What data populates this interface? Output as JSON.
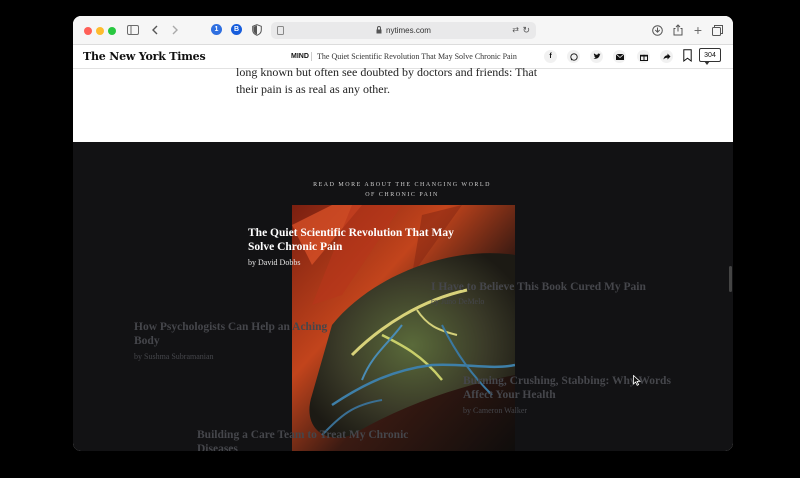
{
  "browser": {
    "url": "nytimes.com",
    "traffic_lights": [
      "#ff5f57",
      "#febc2e",
      "#28c840"
    ],
    "extensions": [
      "1Password",
      "Bitwarden",
      "Privacy shield"
    ]
  },
  "nyt_header": {
    "logo": "The New York Times",
    "section": "MIND",
    "article_title": "The Quiet Scientific Revolution That May Solve Chronic Pain",
    "share_buttons": [
      "facebook",
      "whatsapp",
      "twitter",
      "email",
      "gift",
      "share"
    ],
    "comments_count": "304"
  },
  "article": {
    "text_line1": "long known but often see doubted by doctors and friends: That",
    "text_line2": "their pain is as real as any other."
  },
  "read_more": {
    "label_line1": "READ MORE ABOUT THE CHANGING WORLD",
    "label_line2": "OF CHRONIC PAIN",
    "items": [
      {
        "title_line1": "The Quiet Scientific Revolution That May",
        "title_line2": "Solve Chronic Pain",
        "byline": "by David Dobbs"
      },
      {
        "title_line1": "I Have to Believe This Book Cured My Pain",
        "byline": "by Juno DeMelo"
      },
      {
        "title_line1": "How Psychologists Can Help an Aching",
        "title_line2": "Body",
        "byline": "by Sushma Subramanian"
      },
      {
        "title_line1": "Burning, Crushing, Stabbing: Why Words",
        "title_line2": "Affect Your Health",
        "byline": "by Cameron Walker"
      },
      {
        "title_line1": "Building a Care Team to Treat My Chronic",
        "title_line2": "Diseases"
      }
    ]
  }
}
